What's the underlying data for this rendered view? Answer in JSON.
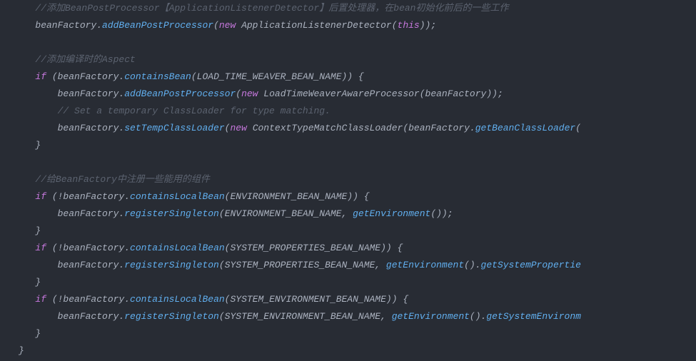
{
  "lines": {
    "c1": "   //添加BeanPostProcessor【ApplicationListenerDetector】后置处理器，在bean初始化前后的一些工作",
    "l2a": "   beanFactory.",
    "l2fn": "addBeanPostProcessor",
    "l2b": "(",
    "l2kw": "new",
    "l2c": " ApplicationListenerDetector(",
    "l2this": "this",
    "l2d": "));",
    "c3": "   //添加编译时的Aspect",
    "l4a": "   ",
    "l4if": "if",
    "l4b": " (beanFactory.",
    "l4fn": "containsBean",
    "l4c": "(LOAD_TIME_WEAVER_BEAN_NAME)) {",
    "l5a": "       beanFactory.",
    "l5fn": "addBeanPostProcessor",
    "l5b": "(",
    "l5kw": "new",
    "l5c": " LoadTimeWeaverAwareProcessor(beanFactory));",
    "c6": "       // Set a temporary ClassLoader for type matching.",
    "l7a": "       beanFactory.",
    "l7fn": "setTempClassLoader",
    "l7b": "(",
    "l7kw": "new",
    "l7c": " ContextTypeMatchClassLoader(beanFactory.",
    "l7fn2": "getBeanClassLoader",
    "l7d": "(",
    "l8": "   }",
    "c9": "   //给BeanFactory中注册一些能用的组件",
    "l10a": "   ",
    "l10if": "if",
    "l10b": " (!beanFactory.",
    "l10fn": "containsLocalBean",
    "l10c": "(ENVIRONMENT_BEAN_NAME)) {",
    "l11a": "       beanFactory.",
    "l11fn": "registerSingleton",
    "l11b": "(ENVIRONMENT_BEAN_NAME, ",
    "l11fn2": "getEnvironment",
    "l11c": "());",
    "l12": "   }",
    "l13a": "   ",
    "l13if": "if",
    "l13b": " (!beanFactory.",
    "l13fn": "containsLocalBean",
    "l13c": "(SYSTEM_PROPERTIES_BEAN_NAME)) {",
    "l14a": "       beanFactory.",
    "l14fn": "registerSingleton",
    "l14b": "(SYSTEM_PROPERTIES_BEAN_NAME, ",
    "l14fn2": "getEnvironment",
    "l14c": "().",
    "l14fn3": "getSystemPropertie",
    "l15": "   }",
    "l16a": "   ",
    "l16if": "if",
    "l16b": " (!beanFactory.",
    "l16fn": "containsLocalBean",
    "l16c": "(SYSTEM_ENVIRONMENT_BEAN_NAME)) {",
    "l17a": "       beanFactory.",
    "l17fn": "registerSingleton",
    "l17b": "(SYSTEM_ENVIRONMENT_BEAN_NAME, ",
    "l17fn2": "getEnvironment",
    "l17c": "().",
    "l17fn3": "getSystemEnvironm",
    "l18": "   }",
    "l19": "}"
  }
}
